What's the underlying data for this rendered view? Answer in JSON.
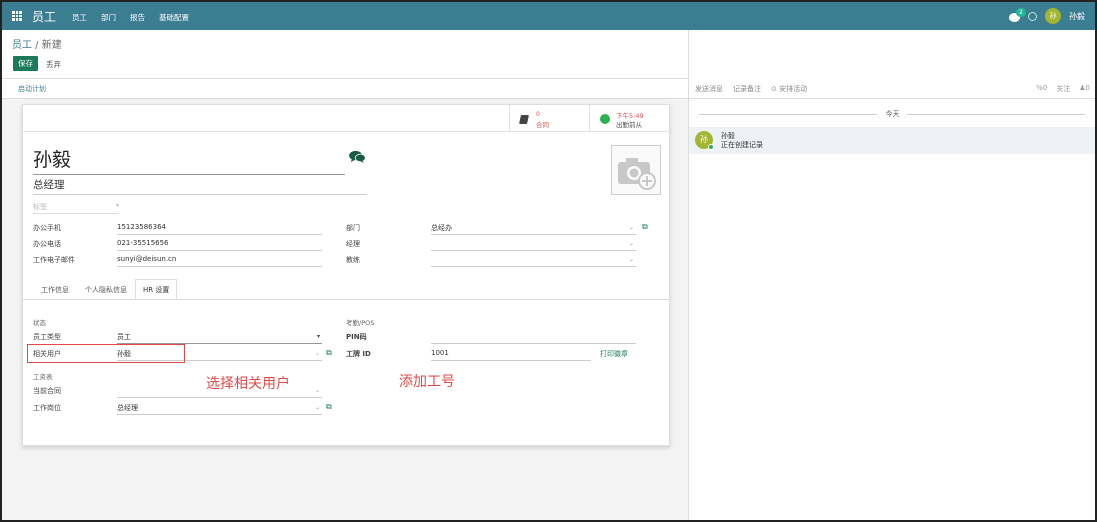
{
  "navbar": {
    "brand": "员工",
    "menu": [
      "员工",
      "部门",
      "报告",
      "基础配置"
    ],
    "chat_badge": "2",
    "user_avatar": "孙",
    "user_name": "孙毅"
  },
  "breadcrumb": {
    "parent": "员工",
    "sep": " / ",
    "current": "新建"
  },
  "buttons": {
    "save": "保存",
    "discard": "丢弃"
  },
  "statusbar": {
    "launch_plan": "启动计划"
  },
  "smart_buttons": {
    "contract_count": "0",
    "contract_label": "合同",
    "presence_time": "下午5:49",
    "presence_label": "出勤前从"
  },
  "employee": {
    "name": "孙毅",
    "job_title": "总经理",
    "tags_placeholder": "标签"
  },
  "fields": {
    "mobile_label": "办公手机",
    "mobile": "15123586364",
    "phone_label": "办公电话",
    "phone": "021-35515656",
    "email_label": "工作电子邮件",
    "email": "sunyi@deisun.cn",
    "department_label": "部门",
    "department": "总经办",
    "manager_label": "经理",
    "manager": "",
    "coach_label": "教练",
    "coach": ""
  },
  "tabs": [
    "工作信息",
    "个人隐私信息",
    "HR 设置"
  ],
  "hr": {
    "status_title": "状态",
    "emp_type_label": "员工类型",
    "emp_type": "员工",
    "related_user_label": "相关用户",
    "related_user": "孙毅",
    "payroll_title": "工资表",
    "contract_label": "当前合同",
    "contract": "",
    "position_label": "工作岗位",
    "position": "总经理",
    "attendance_title": "考勤/POS",
    "pin_label": "PIN码",
    "pin": "",
    "badge_label": "工牌 ID",
    "badge": "1001",
    "print_badge": "打印徽章"
  },
  "annotations": {
    "select_user": "选择相关用户",
    "add_badge": "添加工号"
  },
  "chatter": {
    "send_message": "发送消息",
    "log_note": "记录备注",
    "schedule": "⊙ 安排活动",
    "attachments": "0",
    "follow": "关注",
    "followers": "0",
    "today": "今天",
    "author": "孙毅",
    "author_avatar": "孙",
    "body": "正在创建记录"
  },
  "colors": {
    "navbar": "#3b7d91",
    "primary": "#1a7a5a",
    "annotation": "#e24a4a",
    "presence": "#2cb150"
  }
}
